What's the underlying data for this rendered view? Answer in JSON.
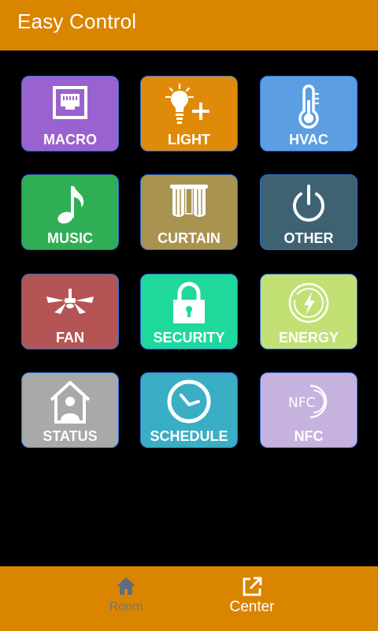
{
  "app": {
    "title": "Easy Control"
  },
  "tiles": [
    {
      "label": "MACRO",
      "icon": "ethernet-port-icon",
      "color": "#9a62d0"
    },
    {
      "label": "LIGHT",
      "icon": "lightbulb-plus-icon",
      "color": "#e08a0a"
    },
    {
      "label": "HVAC",
      "icon": "thermometer-icon",
      "color": "#5b9fe2"
    },
    {
      "label": "MUSIC",
      "icon": "music-note-icon",
      "color": "#2fae55"
    },
    {
      "label": "CURTAIN",
      "icon": "curtain-icon",
      "color": "#a89350"
    },
    {
      "label": "OTHER",
      "icon": "power-icon",
      "color": "#3e6272"
    },
    {
      "label": "FAN",
      "icon": "ceiling-fan-icon",
      "color": "#b55454"
    },
    {
      "label": "SECURITY",
      "icon": "padlock-icon",
      "color": "#1fd89c"
    },
    {
      "label": "ENERGY",
      "icon": "energy-bolt-icon",
      "color": "#c3e075"
    },
    {
      "label": "STATUS",
      "icon": "home-user-icon",
      "color": "#a9a9a9"
    },
    {
      "label": "SCHEDULE",
      "icon": "clock-icon",
      "color": "#3aaec4"
    },
    {
      "label": "NFC",
      "icon": "nfc-icon",
      "color": "#c6b2de"
    }
  ],
  "bottom_nav": {
    "room": {
      "label": "Room",
      "icon": "house-icon",
      "state": "inactive"
    },
    "center": {
      "label": "Center",
      "icon": "open-external-icon",
      "state": "active"
    }
  },
  "colors": {
    "accent": "#d98500",
    "tile_border": "#2f6fd6",
    "background": "#000000"
  }
}
